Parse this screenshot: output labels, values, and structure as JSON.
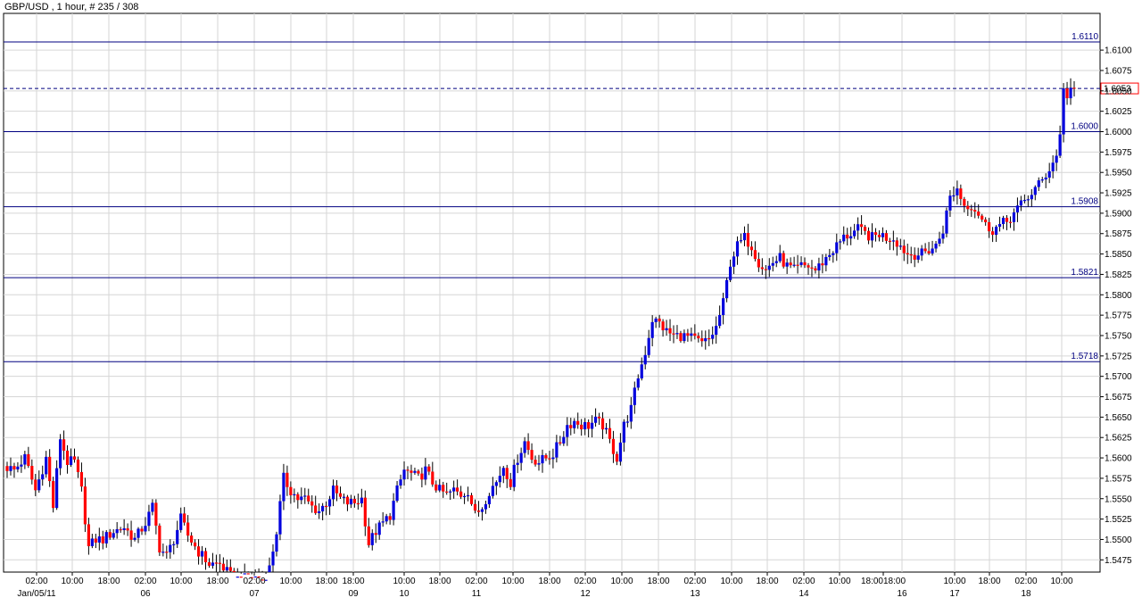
{
  "chart_data": {
    "type": "candlestick",
    "title": "GBP/USD , 1 hour, # 235 / 308",
    "y_range": [
      1.546,
      1.6145
    ],
    "y_ticks": [
      "1.6100",
      "1.6075",
      "1.6050",
      "1.6025",
      "1.6000",
      "1.5975",
      "1.5950",
      "1.5925",
      "1.5900",
      "1.5875",
      "1.5850",
      "1.5825",
      "1.5800",
      "1.5775",
      "1.5750",
      "1.5725",
      "1.5700",
      "1.5675",
      "1.5650",
      "1.5625",
      "1.5600",
      "1.5575",
      "1.5550",
      "1.5525",
      "1.5500",
      "1.5475"
    ],
    "x_tick_labels": [
      "02:00",
      "10:00",
      "18:00",
      "02:00",
      "10:00",
      "18:00",
      "02:00",
      "10:00",
      "18:00",
      "18:00",
      "10:00",
      "18:00",
      "02:00",
      "10:00",
      "18:00",
      "02:00",
      "10:00",
      "18:00",
      "02:00",
      "10:00",
      "18:00",
      "02:00",
      "10:00",
      "18:0018:00",
      "10:00",
      "18:00",
      "02:00",
      "10:00"
    ],
    "x_date_labels": [
      "Jan/05/11",
      "06",
      "07",
      "09",
      "10",
      "11",
      "12",
      "13",
      "14",
      "16",
      "17",
      "18"
    ],
    "grid": true,
    "colors": {
      "up": "#0000dd",
      "down": "#ff0000",
      "wick": "#000000",
      "grid": "#d6d6d6",
      "level": "#000080",
      "current_box": "#ff0000"
    },
    "horizontal_levels": [
      {
        "label": "1.6110",
        "value": 1.611
      },
      {
        "label": "1.6000",
        "value": 1.6
      },
      {
        "label": "1.5908",
        "value": 1.5908
      },
      {
        "label": "1.5821",
        "value": 1.5821
      },
      {
        "label": "1.5718",
        "value": 1.5718
      }
    ],
    "current_price": {
      "label": "1.6053",
      "value": 1.6053
    },
    "trend_path": [
      [
        0,
        1.559
      ],
      [
        3,
        1.5585
      ],
      [
        6,
        1.56
      ],
      [
        9,
        1.556
      ],
      [
        12,
        1.56
      ],
      [
        14,
        1.554
      ],
      [
        16,
        1.5625
      ],
      [
        18,
        1.5595
      ],
      [
        20,
        1.5595
      ],
      [
        22,
        1.556
      ],
      [
        24,
        1.549
      ],
      [
        26,
        1.55
      ],
      [
        28,
        1.55
      ],
      [
        31,
        1.551
      ],
      [
        34,
        1.5515
      ],
      [
        37,
        1.55
      ],
      [
        40,
        1.552
      ],
      [
        42,
        1.554
      ],
      [
        44,
        1.549
      ],
      [
        46,
        1.548
      ],
      [
        48,
        1.55
      ],
      [
        50,
        1.5525
      ],
      [
        52,
        1.5505
      ],
      [
        55,
        1.5485
      ],
      [
        58,
        1.547
      ],
      [
        61,
        1.547
      ],
      [
        64,
        1.5455
      ],
      [
        67,
        1.545
      ],
      [
        70,
        1.5455
      ],
      [
        73,
        1.545
      ],
      [
        75,
        1.5465
      ],
      [
        77,
        1.551
      ],
      [
        79,
        1.5575
      ],
      [
        81,
        1.556
      ],
      [
        83,
        1.555
      ],
      [
        85,
        1.555
      ],
      [
        87,
        1.554
      ],
      [
        89,
        1.5535
      ],
      [
        91,
        1.5545
      ],
      [
        93,
        1.556
      ],
      [
        95,
        1.555
      ],
      [
        97,
        1.5545
      ],
      [
        99,
        1.5545
      ],
      [
        101,
        1.555
      ],
      [
        103,
        1.5495
      ],
      [
        105,
        1.551
      ],
      [
        107,
        1.552
      ],
      [
        109,
        1.553
      ],
      [
        111,
        1.556
      ],
      [
        113,
        1.5585
      ],
      [
        115,
        1.558
      ],
      [
        117,
        1.5575
      ],
      [
        119,
        1.5585
      ],
      [
        121,
        1.557
      ],
      [
        123,
        1.556
      ],
      [
        125,
        1.5555
      ],
      [
        127,
        1.556
      ],
      [
        129,
        1.5555
      ],
      [
        131,
        1.556
      ],
      [
        133,
        1.553
      ],
      [
        135,
        1.554
      ],
      [
        137,
        1.556
      ],
      [
        139,
        1.557
      ],
      [
        141,
        1.559
      ],
      [
        143,
        1.557
      ],
      [
        145,
        1.56
      ],
      [
        147,
        1.562
      ],
      [
        149,
        1.56
      ],
      [
        151,
        1.5595
      ],
      [
        153,
        1.56
      ],
      [
        155,
        1.5605
      ],
      [
        157,
        1.562
      ],
      [
        159,
        1.564
      ],
      [
        161,
        1.5645
      ],
      [
        163,
        1.564
      ],
      [
        165,
        1.564
      ],
      [
        167,
        1.5645
      ],
      [
        169,
        1.564
      ],
      [
        171,
        1.562
      ],
      [
        173,
        1.56
      ],
      [
        175,
        1.564
      ],
      [
        177,
        1.566
      ],
      [
        179,
        1.57
      ],
      [
        181,
        1.573
      ],
      [
        183,
        1.577
      ],
      [
        185,
        1.5765
      ],
      [
        187,
        1.5755
      ],
      [
        189,
        1.575
      ],
      [
        191,
        1.575
      ],
      [
        193,
        1.5748
      ],
      [
        195,
        1.5745
      ],
      [
        197,
        1.574
      ],
      [
        199,
        1.5745
      ],
      [
        201,
        1.576
      ],
      [
        203,
        1.579
      ],
      [
        205,
        1.584
      ],
      [
        207,
        1.586
      ],
      [
        209,
        1.587
      ],
      [
        211,
        1.586
      ],
      [
        213,
        1.584
      ],
      [
        215,
        1.583
      ],
      [
        217,
        1.584
      ],
      [
        219,
        1.5845
      ],
      [
        221,
        1.5835
      ],
      [
        223,
        1.583
      ],
      [
        225,
        1.5835
      ],
      [
        227,
        1.5835
      ],
      [
        229,
        1.583
      ],
      [
        231,
        1.584
      ],
      [
        233,
        1.585
      ],
      [
        235,
        1.586
      ],
      [
        237,
        1.587
      ],
      [
        239,
        1.5875
      ],
      [
        241,
        1.588
      ],
      [
        243,
        1.5875
      ],
      [
        245,
        1.587
      ],
      [
        247,
        1.5875
      ],
      [
        249,
        1.587
      ],
      [
        251,
        1.587
      ],
      [
        253,
        1.586
      ],
      [
        255,
        1.585
      ],
      [
        257,
        1.585
      ],
      [
        259,
        1.585
      ],
      [
        261,
        1.5855
      ],
      [
        263,
        1.586
      ],
      [
        265,
        1.588
      ],
      [
        267,
        1.592
      ],
      [
        269,
        1.593
      ],
      [
        271,
        1.591
      ],
      [
        273,
        1.591
      ],
      [
        275,
        1.59
      ],
      [
        277,
        1.5885
      ],
      [
        279,
        1.588
      ],
      [
        281,
        1.5885
      ],
      [
        283,
        1.589
      ],
      [
        285,
        1.59
      ],
      [
        287,
        1.591
      ],
      [
        289,
        1.592
      ],
      [
        291,
        1.593
      ],
      [
        293,
        1.594
      ],
      [
        295,
        1.5955
      ],
      [
        297,
        1.597
      ],
      [
        298,
        1.6
      ],
      [
        299,
        1.605
      ],
      [
        300,
        1.6045
      ],
      [
        301,
        1.6053
      ]
    ]
  }
}
